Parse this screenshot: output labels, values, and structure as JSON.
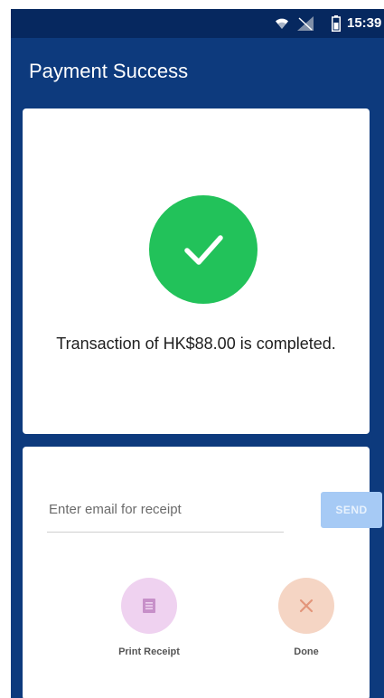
{
  "status_bar": {
    "time": "15:39",
    "icons": [
      "wifi-icon",
      "signal-icon",
      "battery-icon"
    ]
  },
  "app_bar": {
    "title": "Payment Success"
  },
  "result": {
    "icon": "checkmark-icon",
    "message": "Transaction of HK$88.00 is completed."
  },
  "receipt": {
    "email_placeholder": "Enter email for receipt",
    "send_label": "SEND"
  },
  "actions": {
    "print": {
      "label": "Print Receipt",
      "icon": "receipt-icon"
    },
    "done": {
      "label": "Done",
      "icon": "close-icon"
    }
  },
  "colors": {
    "app_bar": "#0d3a7d",
    "status_bar": "#06285f",
    "success": "#22c25a",
    "send_button": "#a6caf5",
    "print_circle": "#efd2f0",
    "done_circle": "#f5d5c4"
  }
}
